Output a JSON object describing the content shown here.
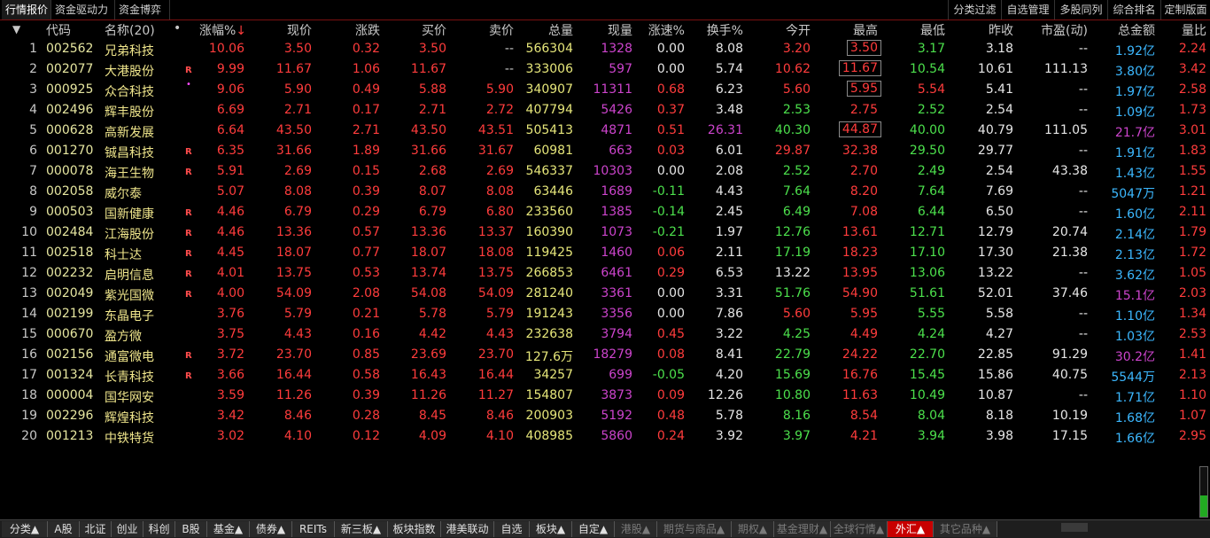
{
  "top_tabs": [
    "行情报价",
    "资金驱动力",
    "资金博弈"
  ],
  "right_tabs": [
    "分类过滤",
    "自选管理",
    "多股同列",
    "综合排名",
    "定制版面"
  ],
  "header": {
    "sort_arrow": "▼",
    "code": "代码",
    "name": "名称(20)",
    "dot": "•",
    "change_pct": "涨幅%",
    "sort_indicator": "↓",
    "price": "现价",
    "change": "涨跌",
    "bid": "买价",
    "ask": "卖价",
    "volume": "总量",
    "cur_vol": "现量",
    "speed": "涨速%",
    "turnover": "换手%",
    "open": "今开",
    "high": "最高",
    "low": "最低",
    "prev_close": "昨收",
    "pe": "市盈(动)",
    "amount": "总金额",
    "ratio": "量比"
  },
  "rows": [
    {
      "idx": "1",
      "code": "002562",
      "name": "兄弟科技",
      "flag": "",
      "dot": "",
      "pct": "10.06",
      "price": "3.50",
      "chg": "0.32",
      "bid": "3.50",
      "ask": "--",
      "vol": "566304",
      "cur": "1328",
      "speed": "0.00",
      "turn": "8.08",
      "open": "3.20",
      "high": "3.50",
      "low": "3.17",
      "prev": "3.18",
      "pe": "--",
      "amt": "1.92亿",
      "ratio": "2.24",
      "open_c": "red",
      "high_c": "red",
      "low_c": "green",
      "speed_c": "white",
      "high_box": true
    },
    {
      "idx": "2",
      "code": "002077",
      "name": "大港股份",
      "flag": "R",
      "dot": "",
      "pct": "9.99",
      "price": "11.67",
      "chg": "1.06",
      "bid": "11.67",
      "ask": "--",
      "vol": "333006",
      "cur": "597",
      "speed": "0.00",
      "turn": "5.74",
      "open": "10.62",
      "high": "11.67",
      "low": "10.54",
      "prev": "10.61",
      "pe": "111.13",
      "amt": "3.80亿",
      "ratio": "3.42",
      "open_c": "red",
      "high_c": "red",
      "low_c": "green",
      "speed_c": "white",
      "high_box": true
    },
    {
      "idx": "3",
      "code": "000925",
      "name": "众合科技",
      "flag": "",
      "dot": "•",
      "pct": "9.06",
      "price": "5.90",
      "chg": "0.49",
      "bid": "5.88",
      "ask": "5.90",
      "vol": "340907",
      "cur": "11311",
      "speed": "0.68",
      "turn": "6.23",
      "open": "5.60",
      "high": "5.95",
      "low": "5.54",
      "prev": "5.41",
      "pe": "--",
      "amt": "1.97亿",
      "ratio": "2.58",
      "open_c": "red",
      "high_c": "red",
      "low_c": "red",
      "speed_c": "red",
      "high_box": true
    },
    {
      "idx": "4",
      "code": "002496",
      "name": "辉丰股份",
      "flag": "",
      "dot": "",
      "pct": "6.69",
      "price": "2.71",
      "chg": "0.17",
      "bid": "2.71",
      "ask": "2.72",
      "vol": "407794",
      "cur": "5426",
      "speed": "0.37",
      "turn": "3.48",
      "open": "2.53",
      "high": "2.75",
      "low": "2.52",
      "prev": "2.54",
      "pe": "--",
      "amt": "1.09亿",
      "ratio": "1.73",
      "open_c": "green",
      "high_c": "red",
      "low_c": "green",
      "speed_c": "red",
      "high_box": false
    },
    {
      "idx": "5",
      "code": "000628",
      "name": "高新发展",
      "flag": "",
      "dot": "",
      "pct": "6.64",
      "price": "43.50",
      "chg": "2.71",
      "bid": "43.50",
      "ask": "43.51",
      "vol": "505413",
      "cur": "4871",
      "speed": "0.51",
      "turn": "26.31",
      "open": "40.30",
      "high": "44.87",
      "low": "40.00",
      "prev": "40.79",
      "pe": "111.05",
      "amt": "21.7亿",
      "ratio": "3.01",
      "open_c": "green",
      "high_c": "red",
      "low_c": "green",
      "speed_c": "red",
      "high_box": true,
      "turn_c": "magenta",
      "amt_c": "magenta"
    },
    {
      "idx": "6",
      "code": "001270",
      "name": "铖昌科技",
      "flag": "R",
      "dot": "",
      "pct": "6.35",
      "price": "31.66",
      "chg": "1.89",
      "bid": "31.66",
      "ask": "31.67",
      "vol": "60981",
      "cur": "663",
      "speed": "0.03",
      "turn": "6.01",
      "open": "29.87",
      "high": "32.38",
      "low": "29.50",
      "prev": "29.77",
      "pe": "--",
      "amt": "1.91亿",
      "ratio": "1.83",
      "open_c": "red",
      "high_c": "red",
      "low_c": "green",
      "speed_c": "red",
      "high_box": false
    },
    {
      "idx": "7",
      "code": "000078",
      "name": "海王生物",
      "flag": "R",
      "dot": "",
      "pct": "5.91",
      "price": "2.69",
      "chg": "0.15",
      "bid": "2.68",
      "ask": "2.69",
      "vol": "546337",
      "cur": "10303",
      "speed": "0.00",
      "turn": "2.08",
      "open": "2.52",
      "high": "2.70",
      "low": "2.49",
      "prev": "2.54",
      "pe": "43.38",
      "amt": "1.43亿",
      "ratio": "1.55",
      "open_c": "green",
      "high_c": "red",
      "low_c": "green",
      "speed_c": "white",
      "high_box": false
    },
    {
      "idx": "8",
      "code": "002058",
      "name": "威尔泰",
      "flag": "",
      "dot": "",
      "pct": "5.07",
      "price": "8.08",
      "chg": "0.39",
      "bid": "8.07",
      "ask": "8.08",
      "vol": "63446",
      "cur": "1689",
      "speed": "-0.11",
      "turn": "4.43",
      "open": "7.64",
      "high": "8.20",
      "low": "7.64",
      "prev": "7.69",
      "pe": "--",
      "amt": "5047万",
      "ratio": "1.21",
      "open_c": "green",
      "high_c": "red",
      "low_c": "green",
      "speed_c": "green",
      "high_box": false
    },
    {
      "idx": "9",
      "code": "000503",
      "name": "国新健康",
      "flag": "R",
      "dot": "",
      "pct": "4.46",
      "price": "6.79",
      "chg": "0.29",
      "bid": "6.79",
      "ask": "6.80",
      "vol": "233560",
      "cur": "1385",
      "speed": "-0.14",
      "turn": "2.45",
      "open": "6.49",
      "high": "7.08",
      "low": "6.44",
      "prev": "6.50",
      "pe": "--",
      "amt": "1.60亿",
      "ratio": "2.11",
      "open_c": "green",
      "high_c": "red",
      "low_c": "green",
      "speed_c": "green",
      "high_box": false
    },
    {
      "idx": "10",
      "code": "002484",
      "name": "江海股份",
      "flag": "R",
      "dot": "",
      "pct": "4.46",
      "price": "13.36",
      "chg": "0.57",
      "bid": "13.36",
      "ask": "13.37",
      "vol": "160390",
      "cur": "1073",
      "speed": "-0.21",
      "turn": "1.97",
      "open": "12.76",
      "high": "13.61",
      "low": "12.71",
      "prev": "12.79",
      "pe": "20.74",
      "amt": "2.14亿",
      "ratio": "1.79",
      "open_c": "green",
      "high_c": "red",
      "low_c": "green",
      "speed_c": "green",
      "high_box": false
    },
    {
      "idx": "11",
      "code": "002518",
      "name": "科士达",
      "flag": "R",
      "dot": "",
      "pct": "4.45",
      "price": "18.07",
      "chg": "0.77",
      "bid": "18.07",
      "ask": "18.08",
      "vol": "119425",
      "cur": "1460",
      "speed": "0.06",
      "turn": "2.11",
      "open": "17.19",
      "high": "18.23",
      "low": "17.10",
      "prev": "17.30",
      "pe": "21.38",
      "amt": "2.13亿",
      "ratio": "1.72",
      "open_c": "green",
      "high_c": "red",
      "low_c": "green",
      "speed_c": "red",
      "high_box": false
    },
    {
      "idx": "12",
      "code": "002232",
      "name": "启明信息",
      "flag": "R",
      "dot": "",
      "pct": "4.01",
      "price": "13.75",
      "chg": "0.53",
      "bid": "13.74",
      "ask": "13.75",
      "vol": "266853",
      "cur": "6461",
      "speed": "0.29",
      "turn": "6.53",
      "open": "13.22",
      "high": "13.95",
      "low": "13.06",
      "prev": "13.22",
      "pe": "--",
      "amt": "3.62亿",
      "ratio": "1.05",
      "open_c": "white",
      "high_c": "red",
      "low_c": "green",
      "speed_c": "red",
      "high_box": false
    },
    {
      "idx": "13",
      "code": "002049",
      "name": "紫光国微",
      "flag": "R",
      "dot": "",
      "pct": "4.00",
      "price": "54.09",
      "chg": "2.08",
      "bid": "54.08",
      "ask": "54.09",
      "vol": "281240",
      "cur": "3361",
      "speed": "0.00",
      "turn": "3.31",
      "open": "51.76",
      "high": "54.90",
      "low": "51.61",
      "prev": "52.01",
      "pe": "37.46",
      "amt": "15.1亿",
      "ratio": "2.03",
      "open_c": "green",
      "high_c": "red",
      "low_c": "green",
      "speed_c": "white",
      "high_box": false,
      "amt_c": "magenta"
    },
    {
      "idx": "14",
      "code": "002199",
      "name": "东晶电子",
      "flag": "",
      "dot": "",
      "pct": "3.76",
      "price": "5.79",
      "chg": "0.21",
      "bid": "5.78",
      "ask": "5.79",
      "vol": "191243",
      "cur": "3356",
      "speed": "0.00",
      "turn": "7.86",
      "open": "5.60",
      "high": "5.95",
      "low": "5.55",
      "prev": "5.58",
      "pe": "--",
      "amt": "1.10亿",
      "ratio": "1.34",
      "open_c": "red",
      "high_c": "red",
      "low_c": "green",
      "speed_c": "white",
      "high_box": false
    },
    {
      "idx": "15",
      "code": "000670",
      "name": "盈方微",
      "flag": "",
      "dot": "",
      "pct": "3.75",
      "price": "4.43",
      "chg": "0.16",
      "bid": "4.42",
      "ask": "4.43",
      "vol": "232638",
      "cur": "3794",
      "speed": "0.45",
      "turn": "3.22",
      "open": "4.25",
      "high": "4.49",
      "low": "4.24",
      "prev": "4.27",
      "pe": "--",
      "amt": "1.03亿",
      "ratio": "2.53",
      "open_c": "green",
      "high_c": "red",
      "low_c": "green",
      "speed_c": "red",
      "high_box": false
    },
    {
      "idx": "16",
      "code": "002156",
      "name": "通富微电",
      "flag": "R",
      "dot": "",
      "pct": "3.72",
      "price": "23.70",
      "chg": "0.85",
      "bid": "23.69",
      "ask": "23.70",
      "vol": "127.6万",
      "cur": "18279",
      "speed": "0.08",
      "turn": "8.41",
      "open": "22.79",
      "high": "24.22",
      "low": "22.70",
      "prev": "22.85",
      "pe": "91.29",
      "amt": "30.2亿",
      "ratio": "1.41",
      "open_c": "green",
      "high_c": "red",
      "low_c": "green",
      "speed_c": "red",
      "high_box": false,
      "amt_c": "magenta"
    },
    {
      "idx": "17",
      "code": "001324",
      "name": "长青科技",
      "flag": "R",
      "dot": "",
      "pct": "3.66",
      "price": "16.44",
      "chg": "0.58",
      "bid": "16.43",
      "ask": "16.44",
      "vol": "34257",
      "cur": "699",
      "speed": "-0.05",
      "turn": "4.20",
      "open": "15.69",
      "high": "16.76",
      "low": "15.45",
      "prev": "15.86",
      "pe": "40.75",
      "amt": "5544万",
      "ratio": "2.13",
      "open_c": "green",
      "high_c": "red",
      "low_c": "green",
      "speed_c": "green",
      "high_box": false
    },
    {
      "idx": "18",
      "code": "000004",
      "name": "国华网安",
      "flag": "",
      "dot": "",
      "pct": "3.59",
      "price": "11.26",
      "chg": "0.39",
      "bid": "11.26",
      "ask": "11.27",
      "vol": "154807",
      "cur": "3873",
      "speed": "0.09",
      "turn": "12.26",
      "open": "10.80",
      "high": "11.63",
      "low": "10.49",
      "prev": "10.87",
      "pe": "--",
      "amt": "1.71亿",
      "ratio": "1.10",
      "open_c": "green",
      "high_c": "red",
      "low_c": "green",
      "speed_c": "red",
      "high_box": false
    },
    {
      "idx": "19",
      "code": "002296",
      "name": "辉煌科技",
      "flag": "",
      "dot": "",
      "pct": "3.42",
      "price": "8.46",
      "chg": "0.28",
      "bid": "8.45",
      "ask": "8.46",
      "vol": "200903",
      "cur": "5192",
      "speed": "0.48",
      "turn": "5.78",
      "open": "8.16",
      "high": "8.54",
      "low": "8.04",
      "prev": "8.18",
      "pe": "10.19",
      "amt": "1.68亿",
      "ratio": "1.07",
      "open_c": "green",
      "high_c": "red",
      "low_c": "green",
      "speed_c": "red",
      "high_box": false
    },
    {
      "idx": "20",
      "code": "001213",
      "name": "中铁特货",
      "flag": "",
      "dot": "",
      "pct": "3.02",
      "price": "4.10",
      "chg": "0.12",
      "bid": "4.09",
      "ask": "4.10",
      "vol": "408985",
      "cur": "5860",
      "speed": "0.24",
      "turn": "3.92",
      "open": "3.97",
      "high": "4.21",
      "low": "3.94",
      "prev": "3.98",
      "pe": "17.15",
      "amt": "1.66亿",
      "ratio": "2.95",
      "open_c": "green",
      "high_c": "red",
      "low_c": "green",
      "speed_c": "red",
      "high_box": false
    }
  ],
  "bottom_tabs": [
    {
      "label": "分类▲",
      "state": ""
    },
    {
      "label": "A股",
      "state": ""
    },
    {
      "label": "北证",
      "state": ""
    },
    {
      "label": "创业",
      "state": ""
    },
    {
      "label": "科创",
      "state": ""
    },
    {
      "label": "B股",
      "state": ""
    },
    {
      "label": "基金▲",
      "state": ""
    },
    {
      "label": "债券▲",
      "state": ""
    },
    {
      "label": "REITs",
      "state": ""
    },
    {
      "label": "新三板▲",
      "state": ""
    },
    {
      "label": "板块指数",
      "state": ""
    },
    {
      "label": "港美联动",
      "state": ""
    },
    {
      "label": "自选",
      "state": ""
    },
    {
      "label": "板块▲",
      "state": ""
    },
    {
      "label": "自定▲",
      "state": ""
    },
    {
      "label": "港股▲",
      "state": "dim"
    },
    {
      "label": "期货与商品▲",
      "state": "dim"
    },
    {
      "label": "期权▲",
      "state": "dim"
    },
    {
      "label": "基金理财▲",
      "state": "dim"
    },
    {
      "label": "全球行情▲",
      "state": "dim"
    },
    {
      "label": "外汇▲",
      "state": "active"
    },
    {
      "label": "其它品种▲",
      "state": "dim"
    }
  ],
  "colors": {
    "up": "#ff3c3c",
    "down": "#4ce04c",
    "flat": "#e6e6e6",
    "volume": "#e6e67a",
    "cur_vol": "#cc44cc",
    "amount": "#3cb8ff",
    "accent": "#c80000"
  }
}
